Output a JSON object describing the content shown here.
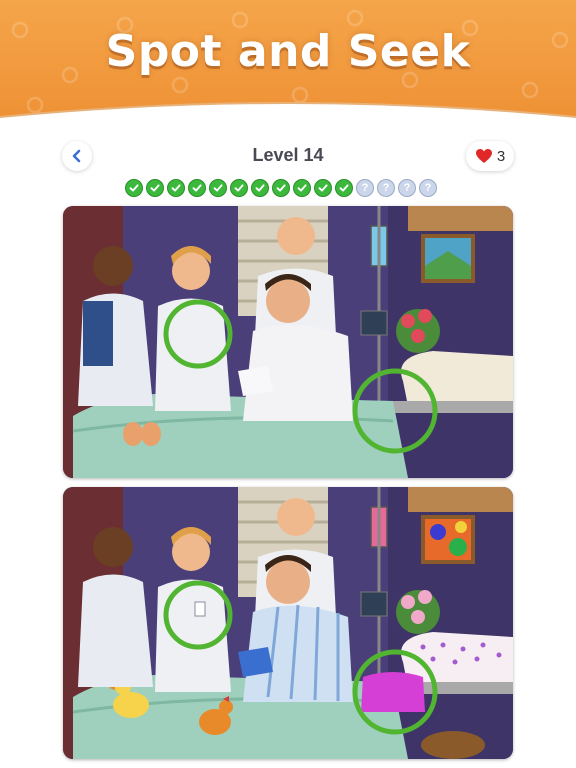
{
  "banner": {
    "title": "Spot and Seek"
  },
  "header": {
    "level_label": "Level 14",
    "lives": "3"
  },
  "progress": {
    "found": 11,
    "total": 15,
    "unknown_glyph": "?"
  },
  "icons": {
    "back": "chevron-left-icon",
    "lives": "heart-icon",
    "found": "check-icon",
    "unfound": "question-icon"
  },
  "colors": {
    "banner": "#ee8f33",
    "found_marker": "#3cb93c",
    "heart": "#e02828",
    "circle_highlight": "#52b531"
  },
  "scene": {
    "top_panel": "original",
    "bottom_panel": "altered",
    "found_circles": 2
  }
}
